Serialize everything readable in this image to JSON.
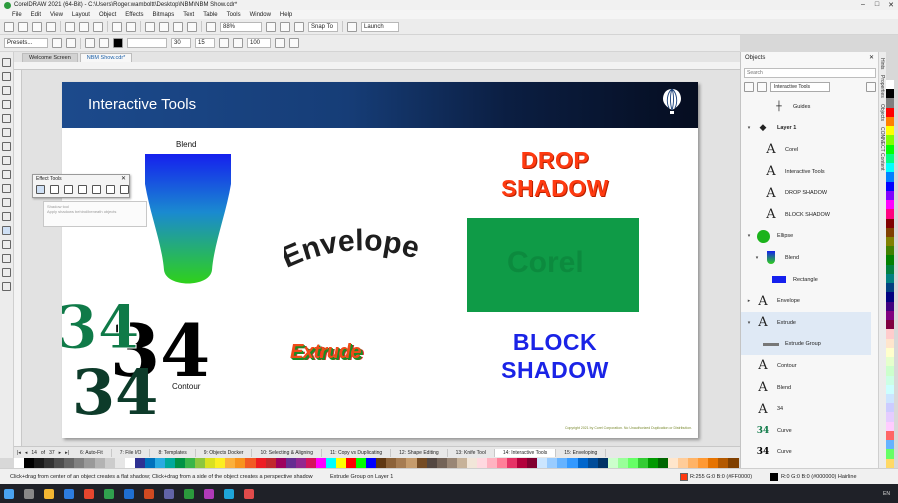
{
  "titlebar": {
    "title": "CorelDRAW 2021 (64-Bit) - C:\\Users\\Roger.wamboltt\\Desktop\\NBM\\NBM Show.cdr*"
  },
  "menu": [
    "File",
    "Edit",
    "View",
    "Layout",
    "Object",
    "Effects",
    "Bitmaps",
    "Text",
    "Table",
    "Tools",
    "Window",
    "Help"
  ],
  "toolbar": {
    "zoom": "88%",
    "snap_to": "Snap To",
    "launch": "Launch"
  },
  "propertybar": {
    "presets": "Presets...",
    "field_a": "30",
    "field_b": "15",
    "field_c": "100"
  },
  "doc_tabs": [
    {
      "label": "Welcome Screen",
      "active": false
    },
    {
      "label": "NBM Show.cdr*",
      "active": true
    }
  ],
  "slide": {
    "title": "Interactive Tools",
    "blend_label": "Blend",
    "envelope": "Envelope",
    "drop_shadow_line1": "DROP",
    "drop_shadow_line2": "SHADOW",
    "block_shadow_line1": "BLOCK",
    "block_shadow_line2": "SHADOW",
    "extrude": "Extrude",
    "contour_label": "Contour",
    "contour_number": "34",
    "footer": "Copyright 2021 by Corel Corporation. No Unauthorized Duplication or Distribution."
  },
  "effect_tools": {
    "title": "Effect Tools",
    "close": "✕",
    "tooltip_title": "Shadow tool",
    "tooltip_body": "Apply shadows behind/beneath objects"
  },
  "page_nav": {
    "current": "14",
    "of": "of",
    "total": "37"
  },
  "page_tabs": [
    {
      "label": "6: Auto-Fit",
      "active": false
    },
    {
      "label": "7: File I/O",
      "active": false
    },
    {
      "label": "8: Templates",
      "active": false
    },
    {
      "label": "9: Objects Docker",
      "active": false
    },
    {
      "label": "10: Selecting & Aligning",
      "active": false
    },
    {
      "label": "11: Copy vs Duplicating",
      "active": false
    },
    {
      "label": "12: Shape Editing",
      "active": false
    },
    {
      "label": "13: Knife Tool",
      "active": false
    },
    {
      "label": "14: Interactive Tools",
      "active": true
    },
    {
      "label": "15: Enveloping",
      "active": false
    }
  ],
  "status": {
    "hint": "Click+drag from center of an object creates a flat shadow; Click+drag from a side of the object creates a perspective shadow",
    "selection": "Extrude Group on Layer 1",
    "fill": "R:255 G:0 B:0 (#FF0000)",
    "outline": "R:0 G:0 B:0 (#000000)  Hairline"
  },
  "docker": {
    "title": "Objects",
    "close": "✕",
    "search_placeholder": "Search",
    "filter": "Interactive Tools",
    "side_tabs": [
      "Hints",
      "Properties",
      "Objects",
      "CONNECT Content"
    ],
    "items": [
      {
        "name": "Guides",
        "indent": 2,
        "thumb": "guides",
        "twist": ""
      },
      {
        "name": "Layer 1",
        "indent": 0,
        "thumb": "layer",
        "twist": "▾"
      },
      {
        "name": "Corel",
        "indent": 1,
        "thumb": "A",
        "twist": ""
      },
      {
        "name": "Interactive Tools",
        "indent": 1,
        "thumb": "A",
        "twist": ""
      },
      {
        "name": "DROP SHADOW",
        "indent": 1,
        "thumb": "A",
        "twist": ""
      },
      {
        "name": "BLOCK SHADOW",
        "indent": 1,
        "thumb": "A",
        "twist": ""
      },
      {
        "name": "Ellipse",
        "indent": 0,
        "thumb": "ellipse",
        "twist": "▾"
      },
      {
        "name": "Blend",
        "indent": 1,
        "thumb": "blend",
        "twist": "▾"
      },
      {
        "name": "Rectangle",
        "indent": 2,
        "thumb": "rect",
        "twist": ""
      },
      {
        "name": "Envelope",
        "indent": 0,
        "thumb": "A",
        "twist": "▸"
      },
      {
        "name": "Extrude",
        "indent": 0,
        "thumb": "A",
        "twist": "▾",
        "selected": true
      },
      {
        "name": "Extrude Group",
        "indent": 1,
        "thumb": "extrude",
        "twist": "",
        "selected": true
      },
      {
        "name": "Contour",
        "indent": 0,
        "thumb": "A",
        "twist": ""
      },
      {
        "name": "Blend",
        "indent": 0,
        "thumb": "A",
        "twist": ""
      },
      {
        "name": "34",
        "indent": 0,
        "thumb": "A",
        "twist": ""
      },
      {
        "name": "Curve",
        "indent": 0,
        "thumb": "34g",
        "twist": ""
      },
      {
        "name": "Curve",
        "indent": 0,
        "thumb": "34k",
        "twist": ""
      }
    ]
  },
  "palette": [
    "#ffffff",
    "#000000",
    "#1a1a1a",
    "#333333",
    "#4d4d4d",
    "#666666",
    "#808080",
    "#999999",
    "#b3b3b3",
    "#cccccc",
    "#e6e6e6",
    "#ffffff",
    "#2e3192",
    "#0071bc",
    "#29abe2",
    "#00a99d",
    "#009245",
    "#39b54a",
    "#8cc63f",
    "#d9e021",
    "#fcee21",
    "#fbb03b",
    "#f7931e",
    "#f15a24",
    "#ed1c24",
    "#c1272d",
    "#9e005d",
    "#662d91",
    "#93278f",
    "#d4145a",
    "#ff00ff",
    "#00ffff",
    "#ffff00",
    "#ff0000",
    "#00ff00",
    "#0000ff",
    "#603813",
    "#8c6239",
    "#a67c52",
    "#c69c6d",
    "#754c24",
    "#534741",
    "#736357",
    "#998675",
    "#c7b299",
    "#f2e6d9",
    "#ffd9e0",
    "#ffb3c1",
    "#ff8099",
    "#e63366",
    "#b3003b",
    "#800030",
    "#cce6ff",
    "#99ccff",
    "#66b3ff",
    "#3399ff",
    "#0066cc",
    "#004c99",
    "#003366",
    "#ccffcc",
    "#99ff99",
    "#66ff66",
    "#33cc33",
    "#009900",
    "#006600",
    "#ffe6cc",
    "#ffcc99",
    "#ffb366",
    "#ff9933",
    "#e67300",
    "#b35900",
    "#804000"
  ],
  "vpalette": [
    "#ffffff",
    "#000000",
    "#808080",
    "#ff0000",
    "#ff8000",
    "#ffff00",
    "#80ff00",
    "#00ff00",
    "#00ff80",
    "#00ffff",
    "#0080ff",
    "#0000ff",
    "#8000ff",
    "#ff00ff",
    "#ff0080",
    "#800000",
    "#804000",
    "#808000",
    "#408000",
    "#008000",
    "#008040",
    "#008080",
    "#004080",
    "#000080",
    "#400080",
    "#800080",
    "#800040",
    "#ffcccc",
    "#ffe5cc",
    "#ffffcc",
    "#e5ffcc",
    "#ccffcc",
    "#ccffe5",
    "#ccffff",
    "#cce5ff",
    "#ccccff",
    "#e5ccff",
    "#ffccff",
    "#ff6666",
    "#66b3ff",
    "#66ff66",
    "#ffd966"
  ],
  "taskbar": {
    "lang": "EN",
    "time": ""
  }
}
